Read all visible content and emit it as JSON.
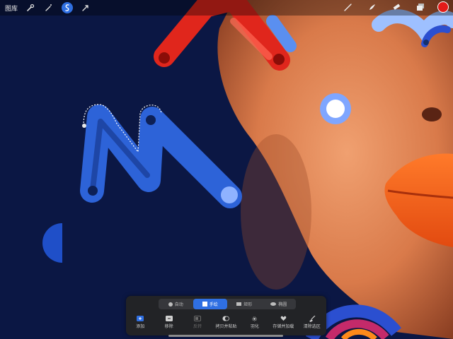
{
  "topbar": {
    "gallery_label": "图库",
    "left_tools": [
      "wrench-icon",
      "magic-wand-icon",
      "selection-icon",
      "transform-icon"
    ],
    "active_tool": "selection-icon",
    "right_tools": [
      "brush-icon",
      "smudge-icon",
      "eraser-icon",
      "layers-icon"
    ],
    "current_color": "#e21b18"
  },
  "selection_panel": {
    "modes": [
      {
        "label": "自动",
        "icon": "auto-icon"
      },
      {
        "label": "手绘",
        "icon": "freehand-icon"
      },
      {
        "label": "矩形",
        "icon": "rectangle-icon"
      },
      {
        "label": "椭圆",
        "icon": "ellipse-icon"
      }
    ],
    "active_mode": "手绘",
    "actions": [
      {
        "label": "添加",
        "icon": "add-icon",
        "enabled": true
      },
      {
        "label": "移除",
        "icon": "remove-icon",
        "enabled": true
      },
      {
        "label": "反转",
        "icon": "invert-icon",
        "enabled": false
      },
      {
        "label": "拷贝并粘贴",
        "icon": "copy-paste-icon",
        "enabled": true
      },
      {
        "label": "羽化",
        "icon": "feather-icon",
        "enabled": true
      },
      {
        "label": "存储并加载",
        "icon": "save-load-icon",
        "enabled": true
      },
      {
        "label": "清除选区",
        "icon": "clear-selection-icon",
        "enabled": true
      }
    ]
  },
  "colors": {
    "accent": "#2f6fe2",
    "panel_bg": "#222326",
    "canvas_bg": "#0b1744"
  }
}
